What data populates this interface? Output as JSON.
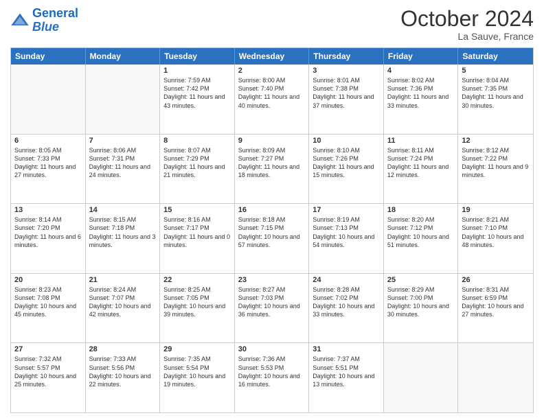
{
  "header": {
    "logo_line1": "General",
    "logo_line2": "Blue",
    "month": "October 2024",
    "location": "La Sauve, France"
  },
  "weekdays": [
    "Sunday",
    "Monday",
    "Tuesday",
    "Wednesday",
    "Thursday",
    "Friday",
    "Saturday"
  ],
  "rows": [
    [
      {
        "day": "",
        "text": "",
        "empty": true
      },
      {
        "day": "",
        "text": "",
        "empty": true
      },
      {
        "day": "1",
        "text": "Sunrise: 7:59 AM\nSunset: 7:42 PM\nDaylight: 11 hours and 43 minutes."
      },
      {
        "day": "2",
        "text": "Sunrise: 8:00 AM\nSunset: 7:40 PM\nDaylight: 11 hours and 40 minutes."
      },
      {
        "day": "3",
        "text": "Sunrise: 8:01 AM\nSunset: 7:38 PM\nDaylight: 11 hours and 37 minutes."
      },
      {
        "day": "4",
        "text": "Sunrise: 8:02 AM\nSunset: 7:36 PM\nDaylight: 11 hours and 33 minutes."
      },
      {
        "day": "5",
        "text": "Sunrise: 8:04 AM\nSunset: 7:35 PM\nDaylight: 11 hours and 30 minutes."
      }
    ],
    [
      {
        "day": "6",
        "text": "Sunrise: 8:05 AM\nSunset: 7:33 PM\nDaylight: 11 hours and 27 minutes."
      },
      {
        "day": "7",
        "text": "Sunrise: 8:06 AM\nSunset: 7:31 PM\nDaylight: 11 hours and 24 minutes."
      },
      {
        "day": "8",
        "text": "Sunrise: 8:07 AM\nSunset: 7:29 PM\nDaylight: 11 hours and 21 minutes."
      },
      {
        "day": "9",
        "text": "Sunrise: 8:09 AM\nSunset: 7:27 PM\nDaylight: 11 hours and 18 minutes."
      },
      {
        "day": "10",
        "text": "Sunrise: 8:10 AM\nSunset: 7:26 PM\nDaylight: 11 hours and 15 minutes."
      },
      {
        "day": "11",
        "text": "Sunrise: 8:11 AM\nSunset: 7:24 PM\nDaylight: 11 hours and 12 minutes."
      },
      {
        "day": "12",
        "text": "Sunrise: 8:12 AM\nSunset: 7:22 PM\nDaylight: 11 hours and 9 minutes."
      }
    ],
    [
      {
        "day": "13",
        "text": "Sunrise: 8:14 AM\nSunset: 7:20 PM\nDaylight: 11 hours and 6 minutes."
      },
      {
        "day": "14",
        "text": "Sunrise: 8:15 AM\nSunset: 7:18 PM\nDaylight: 11 hours and 3 minutes."
      },
      {
        "day": "15",
        "text": "Sunrise: 8:16 AM\nSunset: 7:17 PM\nDaylight: 11 hours and 0 minutes."
      },
      {
        "day": "16",
        "text": "Sunrise: 8:18 AM\nSunset: 7:15 PM\nDaylight: 10 hours and 57 minutes."
      },
      {
        "day": "17",
        "text": "Sunrise: 8:19 AM\nSunset: 7:13 PM\nDaylight: 10 hours and 54 minutes."
      },
      {
        "day": "18",
        "text": "Sunrise: 8:20 AM\nSunset: 7:12 PM\nDaylight: 10 hours and 51 minutes."
      },
      {
        "day": "19",
        "text": "Sunrise: 8:21 AM\nSunset: 7:10 PM\nDaylight: 10 hours and 48 minutes."
      }
    ],
    [
      {
        "day": "20",
        "text": "Sunrise: 8:23 AM\nSunset: 7:08 PM\nDaylight: 10 hours and 45 minutes."
      },
      {
        "day": "21",
        "text": "Sunrise: 8:24 AM\nSunset: 7:07 PM\nDaylight: 10 hours and 42 minutes."
      },
      {
        "day": "22",
        "text": "Sunrise: 8:25 AM\nSunset: 7:05 PM\nDaylight: 10 hours and 39 minutes."
      },
      {
        "day": "23",
        "text": "Sunrise: 8:27 AM\nSunset: 7:03 PM\nDaylight: 10 hours and 36 minutes."
      },
      {
        "day": "24",
        "text": "Sunrise: 8:28 AM\nSunset: 7:02 PM\nDaylight: 10 hours and 33 minutes."
      },
      {
        "day": "25",
        "text": "Sunrise: 8:29 AM\nSunset: 7:00 PM\nDaylight: 10 hours and 30 minutes."
      },
      {
        "day": "26",
        "text": "Sunrise: 8:31 AM\nSunset: 6:59 PM\nDaylight: 10 hours and 27 minutes."
      }
    ],
    [
      {
        "day": "27",
        "text": "Sunrise: 7:32 AM\nSunset: 5:57 PM\nDaylight: 10 hours and 25 minutes."
      },
      {
        "day": "28",
        "text": "Sunrise: 7:33 AM\nSunset: 5:56 PM\nDaylight: 10 hours and 22 minutes."
      },
      {
        "day": "29",
        "text": "Sunrise: 7:35 AM\nSunset: 5:54 PM\nDaylight: 10 hours and 19 minutes."
      },
      {
        "day": "30",
        "text": "Sunrise: 7:36 AM\nSunset: 5:53 PM\nDaylight: 10 hours and 16 minutes."
      },
      {
        "day": "31",
        "text": "Sunrise: 7:37 AM\nSunset: 5:51 PM\nDaylight: 10 hours and 13 minutes."
      },
      {
        "day": "",
        "text": "",
        "empty": true
      },
      {
        "day": "",
        "text": "",
        "empty": true
      }
    ]
  ]
}
